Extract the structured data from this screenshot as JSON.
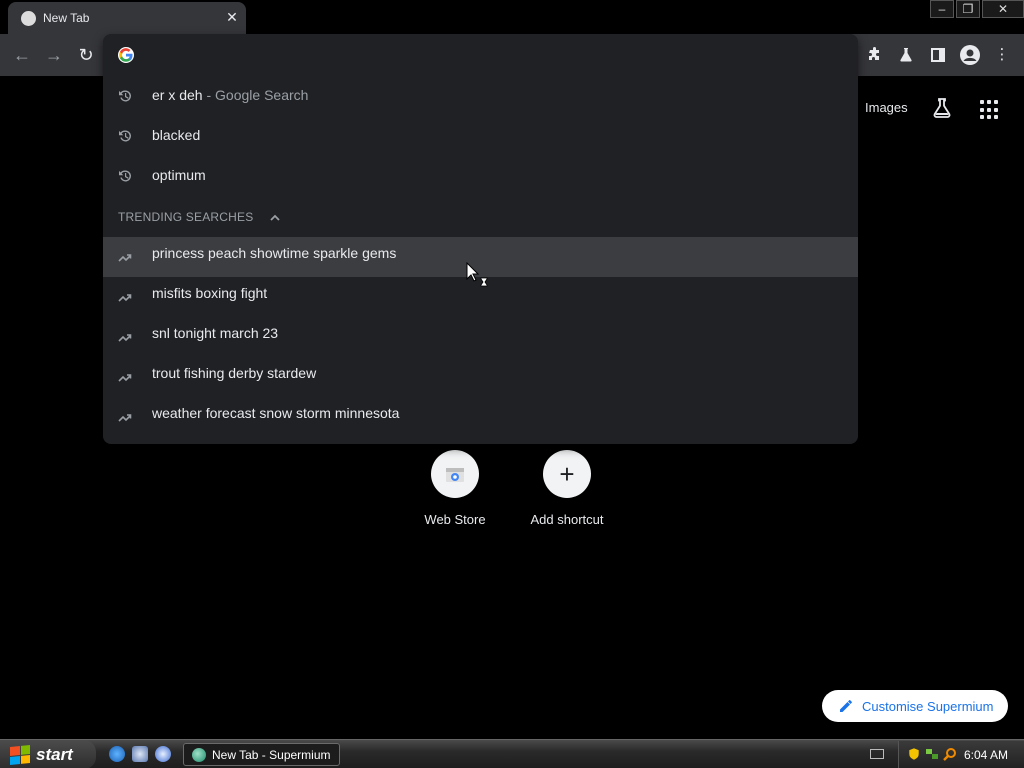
{
  "tab": {
    "title": "New Tab",
    "close": "✕"
  },
  "window_controls": {
    "minimize": "–",
    "restore": "❐",
    "close": "✕"
  },
  "toolbar": {
    "back": "←",
    "forward": "→",
    "reload": "↻",
    "menu": "⋮"
  },
  "omnibox": {
    "value": "",
    "history": [
      {
        "text": "er x deh",
        "suffix": " - Google Search"
      },
      {
        "text": "blacked",
        "suffix": ""
      },
      {
        "text": "optimum",
        "suffix": ""
      }
    ],
    "trending_header": "TRENDING SEARCHES",
    "trending": [
      {
        "text": "princess peach showtime sparkle gems"
      },
      {
        "text": "misfits boxing fight"
      },
      {
        "text": "snl tonight march 23"
      },
      {
        "text": "trout fishing derby stardew"
      },
      {
        "text": "weather forecast snow storm minnesota"
      }
    ]
  },
  "page": {
    "images_link": "Images",
    "shortcuts": [
      {
        "label": "Web Store",
        "icon": "web-store-icon"
      },
      {
        "label": "Add shortcut",
        "icon": "plus-icon",
        "glyph": "+"
      }
    ],
    "customise_button": "Customise Supermium"
  },
  "taskbar": {
    "start_label": "start",
    "task_button": "New Tab - Supermium",
    "clock": "6:04 AM"
  },
  "colors": {
    "omnibox_bg": "#202124",
    "hover_row": "#3c3d40",
    "toolbar_bg": "#35363a",
    "accent_blue": "#1a73e8"
  }
}
